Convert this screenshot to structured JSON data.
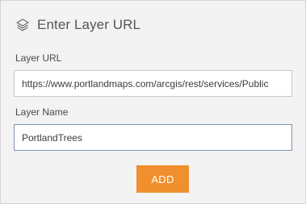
{
  "header": {
    "title": "Enter Layer URL",
    "icon": "layers-icon"
  },
  "form": {
    "url_label": "Layer URL",
    "url_value": "https://www.portlandmaps.com/arcgis/rest/services/Public",
    "name_label": "Layer Name",
    "name_value": "PortlandTrees"
  },
  "actions": {
    "add_label": "ADD"
  },
  "colors": {
    "accent": "#f08f2d",
    "panel_background": "#f3f3f3",
    "focused_border": "#7f93ad"
  }
}
